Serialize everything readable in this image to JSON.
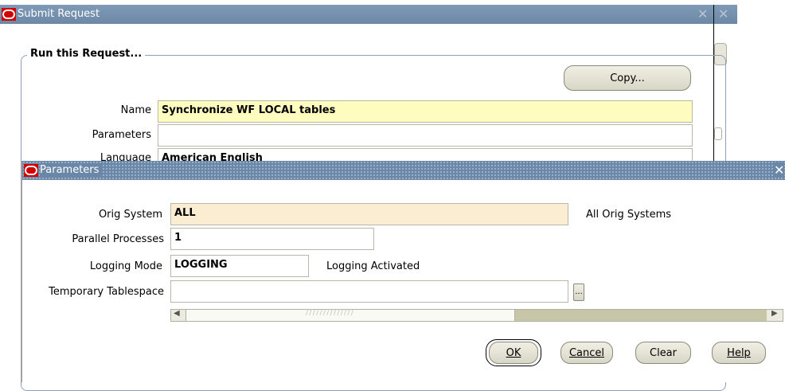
{
  "submit_window": {
    "title": "Submit Request",
    "group_title": "Run this Request...",
    "copy_button": "Copy...",
    "name_label": "Name",
    "name_value": "Synchronize WF LOCAL tables",
    "parameters_label": "Parameters",
    "parameters_value": "",
    "language_label": "Language",
    "language_value": "American English"
  },
  "params_window": {
    "title": "Parameters",
    "orig_system_label": "Orig System",
    "orig_system_value": "ALL",
    "orig_system_desc": "All Orig Systems",
    "parallel_label": "Parallel Processes",
    "parallel_value": "1",
    "logging_label": "Logging Mode",
    "logging_value": "LOGGING",
    "logging_desc": "Logging Activated",
    "temp_ts_label": "Temporary Tablespace",
    "temp_ts_value": "",
    "lov_button": "...",
    "ok_button": "OK",
    "cancel_button": "Cancel",
    "clear_button": "Clear",
    "help_button": "Help"
  },
  "colors": {
    "titlebar": "#6d88a6",
    "required_field": "#fffcc0",
    "current_field": "#fbedd2",
    "oracle_red": "#d00000"
  },
  "icons": [
    "oracle-logo-icon",
    "close-icon",
    "scroll-left-icon",
    "scroll-right-icon",
    "ellipsis-icon"
  ]
}
